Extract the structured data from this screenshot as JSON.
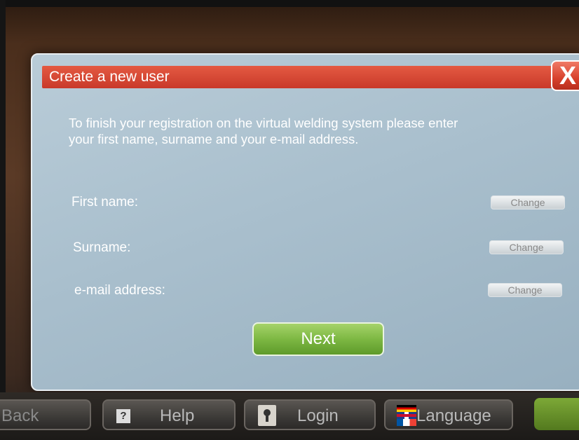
{
  "dialog": {
    "title": "Create a new user",
    "close_label": "X",
    "intro_line1": "To finish your registration on the virtual welding system please enter",
    "intro_line2": "your first name, surname and your e-mail address.",
    "fields": [
      {
        "label": "First name:",
        "button": "Change"
      },
      {
        "label": "Surname:",
        "button": "Change"
      },
      {
        "label": "e-mail address:",
        "button": "Change"
      }
    ],
    "next_label": "Next"
  },
  "taskbar": {
    "back_label": "Back",
    "help_label": "Help",
    "help_icon_glyph": "?",
    "login_label": "Login",
    "language_label": "Language",
    "icons": [
      "help-icon",
      "lock-icon",
      "flag-icon"
    ]
  },
  "colors": {
    "title_bar": "#d6412f",
    "next_button": "#7db843",
    "dialog_bg": "#a9bfcd"
  }
}
